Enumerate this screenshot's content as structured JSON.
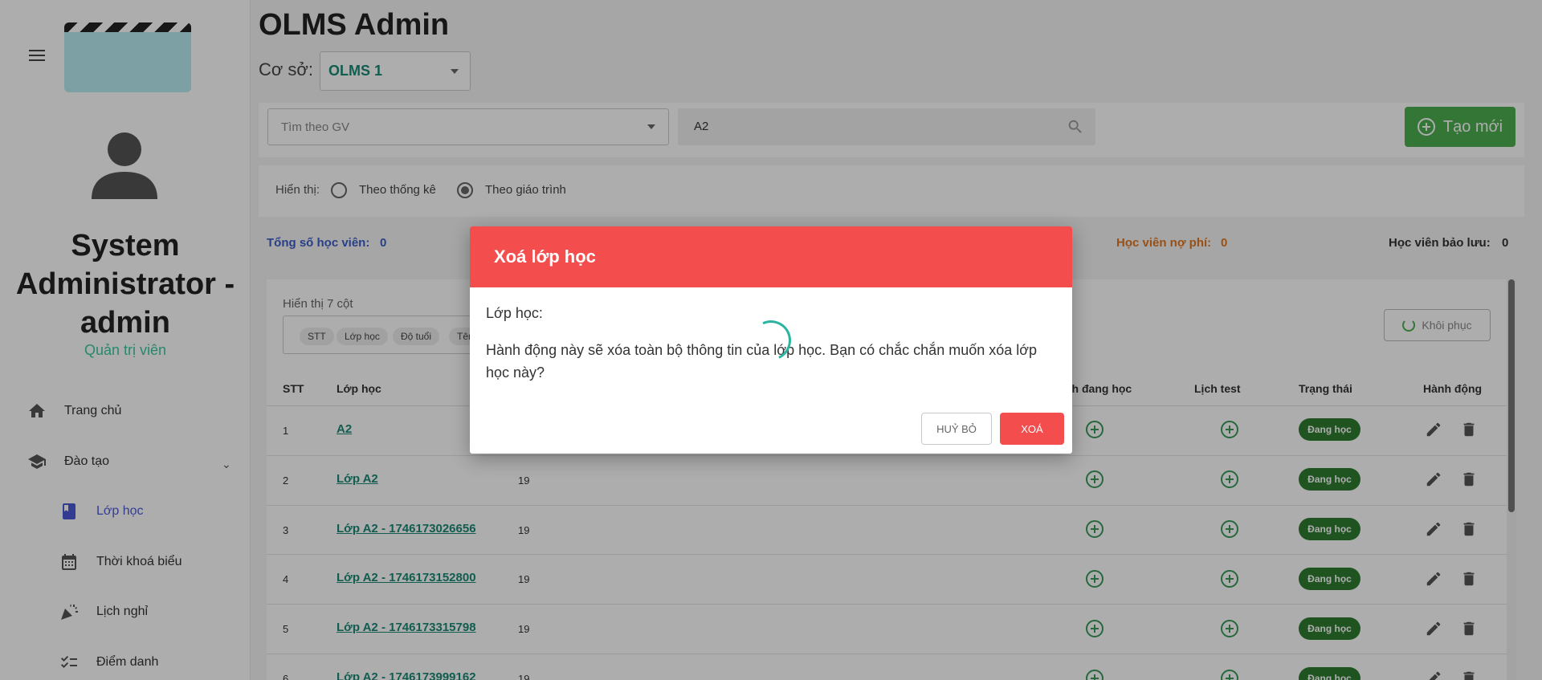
{
  "page": {
    "title": "OLMS Admin",
    "campus_label": "Cơ sở:",
    "campus_value": "OLMS 1"
  },
  "sidebar": {
    "user_name_lines": [
      "System",
      "Administrator -",
      "admin"
    ],
    "user_role": "Quản trị viên",
    "items": [
      {
        "label": "Trang chủ"
      },
      {
        "label": "Đào tạo"
      },
      {
        "label": "Lớp học"
      },
      {
        "label": "Thời khoá biểu"
      },
      {
        "label": "Lịch nghỉ"
      },
      {
        "label": "Điểm danh"
      }
    ]
  },
  "filters": {
    "teacher_placeholder": "Tìm theo GV",
    "search_value": "A2",
    "new_button": "Tạo mới"
  },
  "display": {
    "label": "Hiển thị:",
    "option_stats": "Theo thống kê",
    "option_curriculum": "Theo giáo trình"
  },
  "stats": {
    "total_label": "Tổng số học viên:",
    "total_value": "0",
    "debt_label": "Học viên nợ phí:",
    "debt_value": "0",
    "reserve_label": "Học viên bảo lưu:",
    "reserve_value": "0"
  },
  "table": {
    "columns_label": "Hiển thị 7 cột",
    "chips": [
      "STT",
      "Lớp học",
      "Độ tuổi",
      "Tên"
    ],
    "restore_button": "Khôi phục",
    "headers": {
      "stt": "STT",
      "class": "Lớp học",
      "studying": "nh đang học",
      "test": "Lịch test",
      "status": "Trạng thái",
      "action": "Hành động"
    },
    "rows": [
      {
        "stt": "1",
        "name": "A2",
        "age": "",
        "status": "Đang học"
      },
      {
        "stt": "2",
        "name": "Lớp A2",
        "age": "19",
        "status": "Đang học"
      },
      {
        "stt": "3",
        "name": "Lớp A2 - 1746173026656",
        "age": "19",
        "status": "Đang học"
      },
      {
        "stt": "4",
        "name": "Lớp A2 - 1746173152800",
        "age": "19",
        "status": "Đang học"
      },
      {
        "stt": "5",
        "name": "Lớp A2 - 1746173315798",
        "age": "19",
        "status": "Đang học"
      },
      {
        "stt": "6",
        "name": "Lớp A2 - 1746173999162",
        "age": "19",
        "status": "Đang học"
      }
    ]
  },
  "modal": {
    "title": "Xoá lớp học",
    "label": "Lớp học:",
    "message": "Hành động này sẽ xóa toàn bộ thông tin của lớp học. Bạn có chắc chắn muốn xóa lớp học này?",
    "cancel": "HUỶ BỎ",
    "confirm": "XOÁ"
  },
  "colors": {
    "accent": "#f44d4d",
    "primary_green": "#4caf50",
    "link": "#1a8a76",
    "active_nav": "#4a5ad8"
  }
}
